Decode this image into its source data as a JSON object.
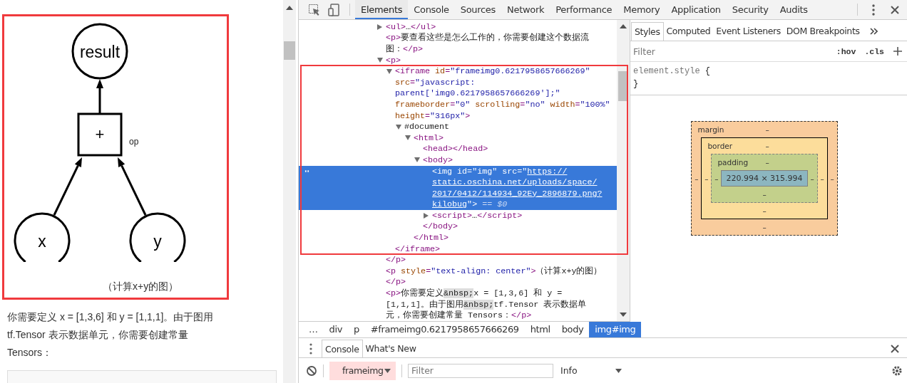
{
  "page": {
    "figure": {
      "nodes": [
        {
          "kind": "circle",
          "label": "result"
        },
        {
          "kind": "square",
          "label": "+",
          "note": "op"
        },
        {
          "kind": "circle",
          "label": "x"
        },
        {
          "kind": "circle",
          "label": "y"
        }
      ]
    },
    "caption": "（计算x+y的图）",
    "paragraph": "你需要定义 x = [1,3,6] 和 y = [1,1,1]。由于图用 tf.Tensor 表示数据单元，你需要创建常量 Tensors："
  },
  "devtools": {
    "tabs": [
      {
        "label": "Elements",
        "selected": true
      },
      {
        "label": "Console",
        "selected": false
      },
      {
        "label": "Sources",
        "selected": false
      },
      {
        "label": "Network",
        "selected": false
      },
      {
        "label": "Performance",
        "selected": false
      },
      {
        "label": "Memory",
        "selected": false
      },
      {
        "label": "Application",
        "selected": false
      },
      {
        "label": "Security",
        "selected": false
      },
      {
        "label": "Audits",
        "selected": false
      }
    ],
    "dom_tree": [
      {
        "expanded": false,
        "lines": [
          [
            {
              "kind": "tag",
              "text": "<ul>"
            },
            {
              "kind": "text",
              "text": "…"
            },
            {
              "kind": "tag",
              "text": "</ul>"
            }
          ]
        ]
      },
      {
        "lines": [
          [
            {
              "kind": "tag",
              "text": "<p>"
            },
            {
              "kind": "text",
              "text": "要查看这些是怎么工作的，你需要创建这个数据流"
            }
          ],
          [
            {
              "kind": "text",
              "text": "图："
            },
            {
              "kind": "tag",
              "text": "</p>"
            }
          ]
        ]
      },
      {
        "expanded": true,
        "lines": [
          [
            {
              "kind": "tag",
              "text": "<p>"
            }
          ]
        ],
        "children": [
          {
            "expanded": true,
            "lines": [
              [
                {
                  "kind": "tag",
                  "text": "<iframe "
                },
                {
                  "kind": "attr",
                  "text": "id"
                },
                {
                  "kind": "tag",
                  "text": "="
                },
                {
                  "kind": "value",
                  "text": "\"frameimg0.6217958657666269\""
                }
              ],
              [
                {
                  "kind": "attr",
                  "text": "src"
                },
                {
                  "kind": "tag",
                  "text": "="
                },
                {
                  "kind": "value",
                  "text": "\"javascript:"
                }
              ],
              [
                {
                  "kind": "value",
                  "text": "parent['img0.6217958657666269'];\""
                }
              ],
              [
                {
                  "kind": "attr",
                  "text": "frameborder"
                },
                {
                  "kind": "tag",
                  "text": "="
                },
                {
                  "kind": "value",
                  "text": "\"0\""
                },
                {
                  "kind": "attr",
                  "text": " scrolling"
                },
                {
                  "kind": "tag",
                  "text": "="
                },
                {
                  "kind": "value",
                  "text": "\"no\""
                },
                {
                  "kind": "attr",
                  "text": " width"
                },
                {
                  "kind": "tag",
                  "text": "="
                },
                {
                  "kind": "value",
                  "text": "\"100%\""
                }
              ],
              [
                {
                  "kind": "attr",
                  "text": "height"
                },
                {
                  "kind": "tag",
                  "text": "="
                },
                {
                  "kind": "value",
                  "text": "\"316px\""
                },
                {
                  "kind": "tag",
                  "text": ">"
                }
              ]
            ],
            "children": [
              {
                "expanded": true,
                "lines": [
                  [
                    {
                      "kind": "text",
                      "text": "#document"
                    }
                  ]
                ],
                "children": [
                  {
                    "expanded": true,
                    "lines": [
                      [
                        {
                          "kind": "tag",
                          "text": "<html>"
                        }
                      ]
                    ],
                    "children": [
                      {
                        "lines": [
                          [
                            {
                              "kind": "tag",
                              "text": "<head></head>"
                            }
                          ]
                        ]
                      },
                      {
                        "expanded": true,
                        "lines": [
                          [
                            {
                              "kind": "tag",
                              "text": "<body>"
                            }
                          ]
                        ],
                        "children": [
                          {
                            "selected": true,
                            "lines": [
                              [
                                {
                                  "kind": "tag",
                                  "text": "<img "
                                },
                                {
                                  "kind": "attr",
                                  "text": "id"
                                },
                                {
                                  "kind": "tag",
                                  "text": "="
                                },
                                {
                                  "kind": "value",
                                  "text": "\"img\""
                                },
                                {
                                  "kind": "attr",
                                  "text": " src"
                                },
                                {
                                  "kind": "tag",
                                  "text": "="
                                },
                                {
                                  "kind": "value",
                                  "text": "\""
                                },
                                {
                                  "kind": "link",
                                  "text": "https://"
                                }
                              ],
                              [
                                {
                                  "kind": "link",
                                  "text": "static.oschina.net/uploads/space/"
                                }
                              ],
                              [
                                {
                                  "kind": "link",
                                  "text": "2017/0412/114934_92Ey_2896879.png?"
                                }
                              ],
                              [
                                {
                                  "kind": "link",
                                  "text": "kilobug"
                                },
                                {
                                  "kind": "value",
                                  "text": "\""
                                },
                                {
                                  "kind": "tag",
                                  "text": ">"
                                },
                                {
                                  "kind": "dim",
                                  "text": " == "
                                },
                                {
                                  "kind": "var",
                                  "text": "$0"
                                }
                              ]
                            ]
                          },
                          {
                            "expanded": false,
                            "lines": [
                              [
                                {
                                  "kind": "tag",
                                  "text": "<script>"
                                },
                                {
                                  "kind": "text",
                                  "text": "…"
                                },
                                {
                                  "kind": "tag",
                                  "text": "</script>"
                                }
                              ]
                            ]
                          }
                        ],
                        "close": [
                          [
                            {
                              "kind": "tag",
                              "text": "</body>"
                            }
                          ]
                        ]
                      }
                    ],
                    "close": [
                      [
                        {
                          "kind": "tag",
                          "text": "</html>"
                        }
                      ]
                    ]
                  }
                ]
              }
            ],
            "close": [
              [
                {
                  "kind": "tag",
                  "text": "</iframe>"
                }
              ]
            ]
          }
        ],
        "close": [
          [
            {
              "kind": "tag",
              "text": "</p>"
            }
          ]
        ]
      },
      {
        "lines": [
          [
            {
              "kind": "tag",
              "text": "<p "
            },
            {
              "kind": "attr",
              "text": "style"
            },
            {
              "kind": "tag",
              "text": "="
            },
            {
              "kind": "value",
              "text": "\"text-align: center\""
            },
            {
              "kind": "tag",
              "text": ">"
            },
            {
              "kind": "text",
              "text": "（计算x+y的图）"
            }
          ],
          [
            {
              "kind": "tag",
              "text": "</p>"
            }
          ]
        ]
      },
      {
        "lines": [
          [
            {
              "kind": "tag",
              "text": "<p>"
            },
            {
              "kind": "text",
              "text": "你需要定义"
            },
            {
              "kind": "entity",
              "text": "&nbsp;"
            },
            {
              "kind": "text",
              "text": "x = [1,3,6] 和 y ="
            }
          ],
          [
            {
              "kind": "text",
              "text": "[1,1,1]。由于图用"
            },
            {
              "kind": "entity",
              "text": "&nbsp;"
            },
            {
              "kind": "text",
              "text": "tf.Tensor 表示数据单"
            }
          ],
          [
            {
              "kind": "text",
              "text": "元，你需要创建常量 Tensors："
            },
            {
              "kind": "tag",
              "text": "</p>"
            }
          ]
        ]
      }
    ],
    "breadcrumbs": [
      {
        "label": "…",
        "selected": false
      },
      {
        "label": "div",
        "selected": false
      },
      {
        "label": "p",
        "selected": false
      },
      {
        "label": "#frameimg0.6217958657666269",
        "selected": false
      },
      {
        "label": "html",
        "selected": false
      },
      {
        "label": "body",
        "selected": false
      },
      {
        "label": "img#img",
        "selected": true
      }
    ],
    "styles": {
      "tabs": [
        {
          "label": "Styles",
          "selected": true
        },
        {
          "label": "Computed",
          "selected": false
        },
        {
          "label": "Event Listeners",
          "selected": false
        },
        {
          "label": "DOM Breakpoints",
          "selected": false
        }
      ],
      "filter": {
        "placeholder": "Filter"
      },
      "toggles": [
        ":hov",
        ".cls"
      ],
      "rule": {
        "selector": "element.style",
        "open": "{",
        "close": "}"
      },
      "box_model": {
        "margin": {
          "label": "margin",
          "top": "–",
          "right": "–",
          "bottom": "–",
          "left": "–"
        },
        "border": {
          "label": "border",
          "top": "–",
          "right": "–",
          "bottom": "–",
          "left": "–"
        },
        "padding": {
          "label": "padding",
          "top": "–",
          "right": "–",
          "bottom": "–",
          "left": "–"
        },
        "content": "220.994 × 315.994"
      }
    },
    "drawer": {
      "tabs": [
        {
          "label": "Console",
          "selected": true
        },
        {
          "label": "What's New",
          "selected": false
        }
      ],
      "context": "frameimg",
      "filter": {
        "placeholder": "Filter"
      },
      "level": "Info"
    }
  }
}
